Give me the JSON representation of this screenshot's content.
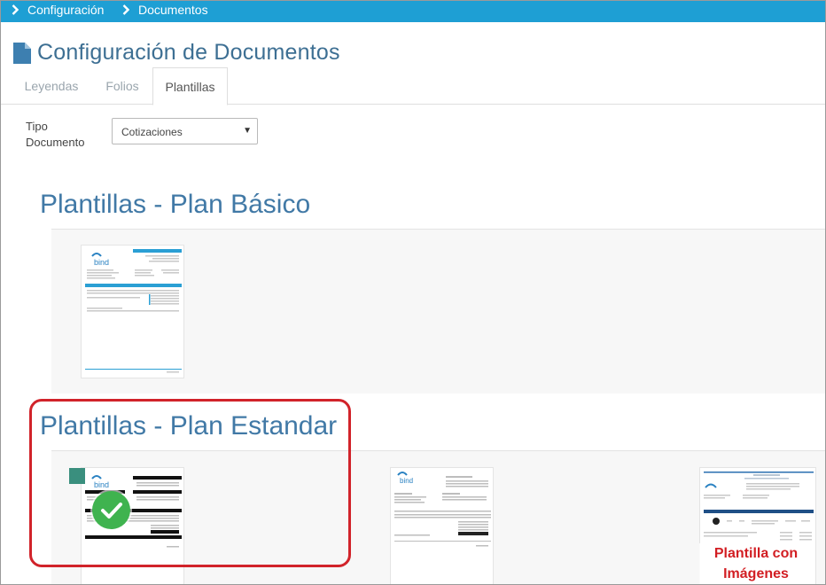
{
  "breadcrumb": {
    "items": [
      "Configuración",
      "Documentos"
    ]
  },
  "page": {
    "title": "Configuración de Documentos"
  },
  "tabs": [
    {
      "label": "Leyendas",
      "active": false
    },
    {
      "label": "Folios",
      "active": false
    },
    {
      "label": "Plantillas",
      "active": true
    }
  ],
  "filter": {
    "label": "Tipo Documento",
    "value": "Cotizaciones",
    "options": [
      "Cotizaciones"
    ]
  },
  "sections": {
    "basico": {
      "title": "Plantillas - Plan Básico"
    },
    "estandar": {
      "title": "Plantillas - Plan Estandar",
      "image_template_caption": "Plantilla con Imágenes"
    }
  },
  "colors": {
    "topbar": "#1e9fd4",
    "heading": "#4179a6",
    "selected_check": "#3fb34f",
    "highlight": "#d1232a",
    "caption": "#d21e23"
  },
  "icons": {
    "breadcrumb_separator": "chevron-right-icon",
    "title": "document-icon",
    "selected": "check-icon"
  }
}
